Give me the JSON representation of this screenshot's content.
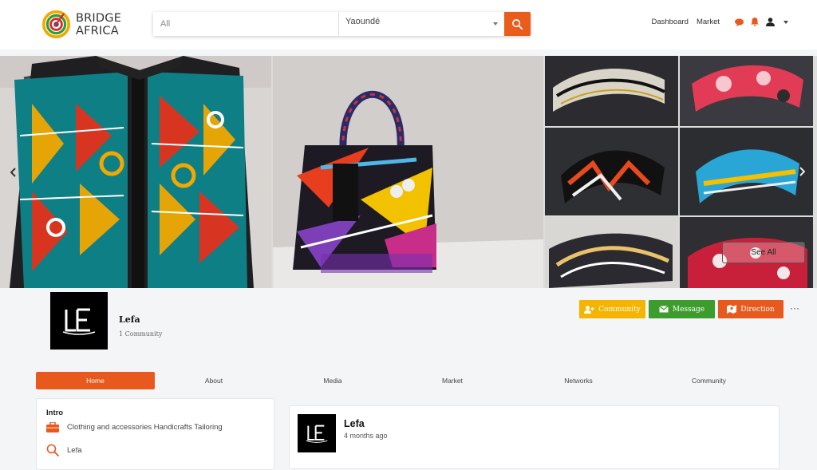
{
  "header": {
    "logo_line1": "BRIDGE",
    "logo_line2": "AFRICA",
    "search_placeholder": "All",
    "location": "Yaoundé",
    "nav": {
      "dashboard": "Dashboard",
      "market": "Market"
    },
    "icons": [
      "search-icon",
      "chat-icon",
      "bell-icon",
      "user-icon",
      "chevron-down-icon"
    ]
  },
  "banner": {
    "see_all": "See All",
    "arrows": [
      "chevron-left-icon",
      "chevron-right-icon"
    ]
  },
  "profile": {
    "name": "Lefa",
    "community_count": "1 Community",
    "actions": {
      "community": "Community",
      "message": "Message",
      "direction": "Direction"
    },
    "more": "···"
  },
  "tabs": [
    {
      "label": "Home",
      "active": true
    },
    {
      "label": "About",
      "active": false
    },
    {
      "label": "Media",
      "active": false
    },
    {
      "label": "Market",
      "active": false
    },
    {
      "label": "Networks",
      "active": false
    },
    {
      "label": "Community",
      "active": false
    }
  ],
  "intro": {
    "title": "Intro",
    "category": "Clothing and accessories Handicrafts Tailoring",
    "name": "Lefa"
  },
  "post": {
    "author": "Lefa",
    "time": "4 months ago"
  },
  "colors": {
    "accent": "#e8591d",
    "community_btn": "#f5b400",
    "message_btn": "#3c9c2c",
    "direction_btn": "#e8591d"
  }
}
